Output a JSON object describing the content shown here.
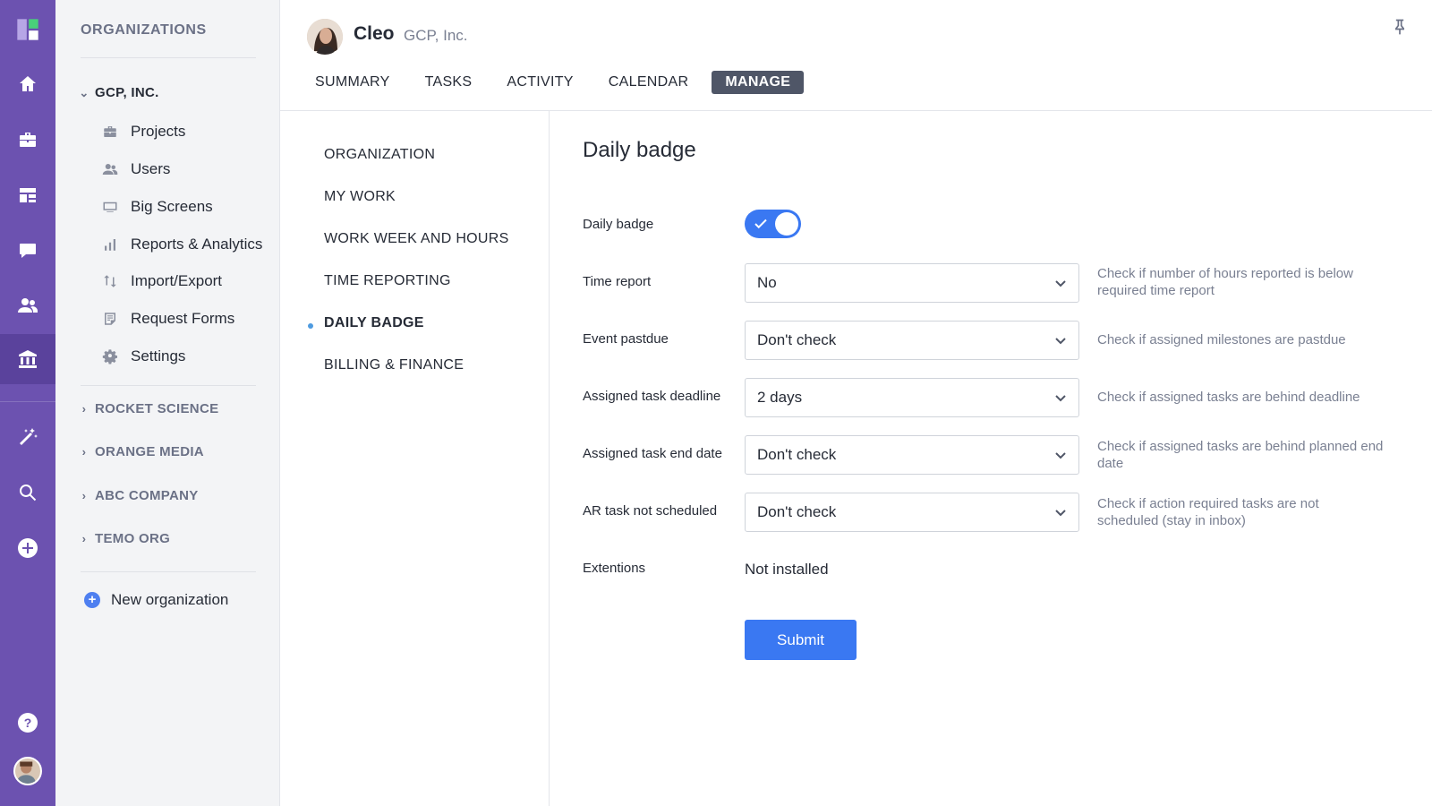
{
  "rail": {
    "items": [
      {
        "icon": "logo-icon"
      },
      {
        "icon": "home-icon"
      },
      {
        "icon": "briefcase-icon"
      },
      {
        "icon": "dashboard-icon"
      },
      {
        "icon": "chat-icon"
      },
      {
        "icon": "users-icon"
      },
      {
        "icon": "bank-icon"
      },
      {
        "icon": "magic-wand-icon"
      },
      {
        "icon": "search-icon"
      },
      {
        "icon": "add-circle-icon"
      },
      {
        "icon": "help-icon"
      }
    ]
  },
  "orgs": {
    "heading": "ORGANIZATIONS",
    "current": "GCP, INC.",
    "items": [
      {
        "label": "Projects",
        "icon": "briefcase-icon"
      },
      {
        "label": "Users",
        "icon": "users-icon"
      },
      {
        "label": "Big Screens",
        "icon": "monitor-icon"
      },
      {
        "label": "Reports & Analytics",
        "icon": "bar-chart-icon"
      },
      {
        "label": "Import/Export",
        "icon": "swap-icon"
      },
      {
        "label": "Request Forms",
        "icon": "form-icon"
      },
      {
        "label": "Settings",
        "icon": "gear-icon"
      }
    ],
    "others": [
      "ROCKET SCIENCE",
      "ORANGE MEDIA",
      "ABC COMPANY",
      "TEMO ORG"
    ],
    "new_org": "New organization"
  },
  "header": {
    "user_name": "Cleo",
    "org_name": "GCP, Inc.",
    "tabs": [
      "SUMMARY",
      "TASKS",
      "ACTIVITY",
      "CALENDAR",
      "MANAGE"
    ],
    "active_tab": "MANAGE"
  },
  "settings_nav": {
    "items": [
      "ORGANIZATION",
      "MY WORK",
      "WORK WEEK AND HOURS",
      "TIME REPORTING",
      "DAILY BADGE",
      "BILLING & FINANCE"
    ],
    "active": "DAILY BADGE"
  },
  "form": {
    "title": "Daily badge",
    "daily_badge_label": "Daily badge",
    "daily_badge_enabled": true,
    "rows": [
      {
        "label": "Time report",
        "value": "No",
        "hint": "Check if number of hours reported is below required time report"
      },
      {
        "label": "Event pastdue",
        "value": "Don't check",
        "hint": "Check if assigned milestones are pastdue"
      },
      {
        "label": "Assigned task deadline",
        "value": "2 days",
        "hint": "Check if assigned tasks are behind deadline"
      },
      {
        "label": "Assigned task end date",
        "value": "Don't check",
        "hint": "Check if assigned tasks are behind planned end date"
      },
      {
        "label": "AR task not scheduled",
        "value": "Don't check",
        "hint": "Check if action required tasks are not scheduled (stay in inbox)"
      }
    ],
    "extensions_label": "Extentions",
    "extensions_value": "Not installed",
    "submit_label": "Submit"
  },
  "colors": {
    "rail": "#6c52b0",
    "accent": "#3a78f2",
    "active_tab": "#4f5667"
  }
}
